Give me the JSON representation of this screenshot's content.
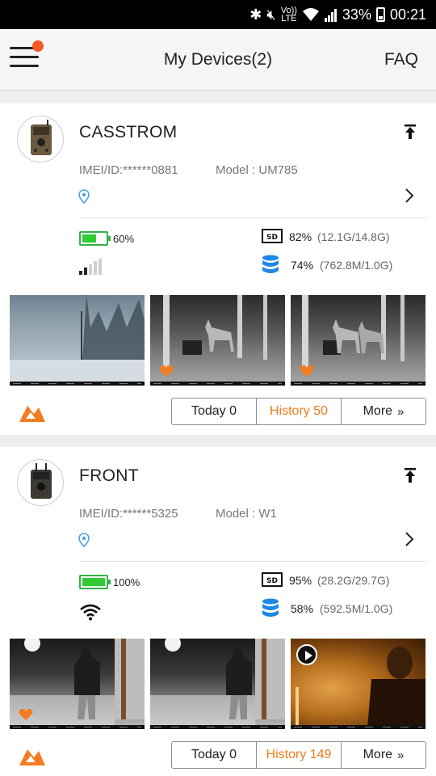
{
  "status_bar": {
    "volte_line1": "Vo))",
    "volte_line2": "LTE",
    "battery_percent": "33%",
    "time": "00:21"
  },
  "header": {
    "title": "My Devices(2)",
    "faq_label": "FAQ",
    "menu_badge_color": "#f15a22"
  },
  "devices": [
    {
      "name": "CASSTROM",
      "imei": "IMEI/ID:******0881",
      "model": "Model : UM785",
      "battery": {
        "label": "60%",
        "level": 0.6
      },
      "signal": "cellular",
      "sd": {
        "percent": "82%",
        "detail": "(12.1G/14.8G)"
      },
      "data": {
        "percent": "74%",
        "detail": "(762.8M/1.0G)"
      },
      "thumbnails": [
        {
          "scene": "snow-forest",
          "favorite": false,
          "video": false
        },
        {
          "scene": "deer-at-night",
          "favorite": true,
          "video": false
        },
        {
          "scene": "two-deer-at-night",
          "favorite": true,
          "video": false
        }
      ],
      "buttons": {
        "today": "Today 0",
        "history": "History 50",
        "more": "More",
        "more_icon": "»"
      }
    },
    {
      "name": "FRONT",
      "imei": "IMEI/ID:******5325",
      "model": "Model : W1",
      "battery": {
        "label": "100%",
        "level": 1.0
      },
      "signal": "wifi",
      "sd": {
        "percent": "95%",
        "detail": "(28.2G/29.7G)"
      },
      "data": {
        "percent": "58%",
        "detail": "(592.5M/1.0G)"
      },
      "thumbnails": [
        {
          "scene": "person-in-snow-night",
          "favorite": true,
          "video": false
        },
        {
          "scene": "person-in-snow-night",
          "favorite": false,
          "video": false
        },
        {
          "scene": "person-warm-light",
          "favorite": false,
          "video": true
        }
      ],
      "buttons": {
        "today": "Today 0",
        "history": "History 149",
        "more": "More",
        "more_icon": "»"
      }
    }
  ],
  "colors": {
    "accent": "#f07c1b",
    "battery_green": "#33cc33",
    "icon_blue": "#1e88e5"
  }
}
